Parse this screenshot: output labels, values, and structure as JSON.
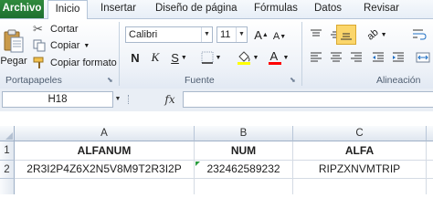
{
  "tabs": {
    "archivo": "Archivo",
    "inicio": "Inicio",
    "insertar": "Insertar",
    "diseno": "Diseño de página",
    "formulas": "Fórmulas",
    "datos": "Datos",
    "revisar": "Revisar"
  },
  "clipboard": {
    "paste": "Pegar",
    "cut": "Cortar",
    "copy": "Copiar",
    "format_painter": "Copiar formato",
    "group_label": "Portapapeles"
  },
  "font": {
    "name": "Calibri",
    "size": "11",
    "bold": "N",
    "italic": "K",
    "underline": "S",
    "grow": "A",
    "shrink": "A",
    "font_color_glyph": "A",
    "group_label": "Fuente"
  },
  "alignment": {
    "group_label": "Alineación"
  },
  "formula_bar": {
    "name_box": "H18",
    "fx": "fx",
    "formula": ""
  },
  "sheet": {
    "columns": [
      "A",
      "B",
      "C"
    ],
    "rows": [
      "1",
      "2"
    ],
    "cells": [
      [
        "ALFANUM",
        "NUM",
        "ALFA"
      ],
      [
        "2R3I2P4Z6X2N5V8M9T2R3I2P",
        "232462589232",
        "RIPZXNVMTRIP"
      ]
    ]
  },
  "colors": {
    "file_tab": "#1e7030",
    "font_color_bar": "#ff0000",
    "highlight_bar": "#ffff00",
    "active_button": "#fbd66b"
  }
}
